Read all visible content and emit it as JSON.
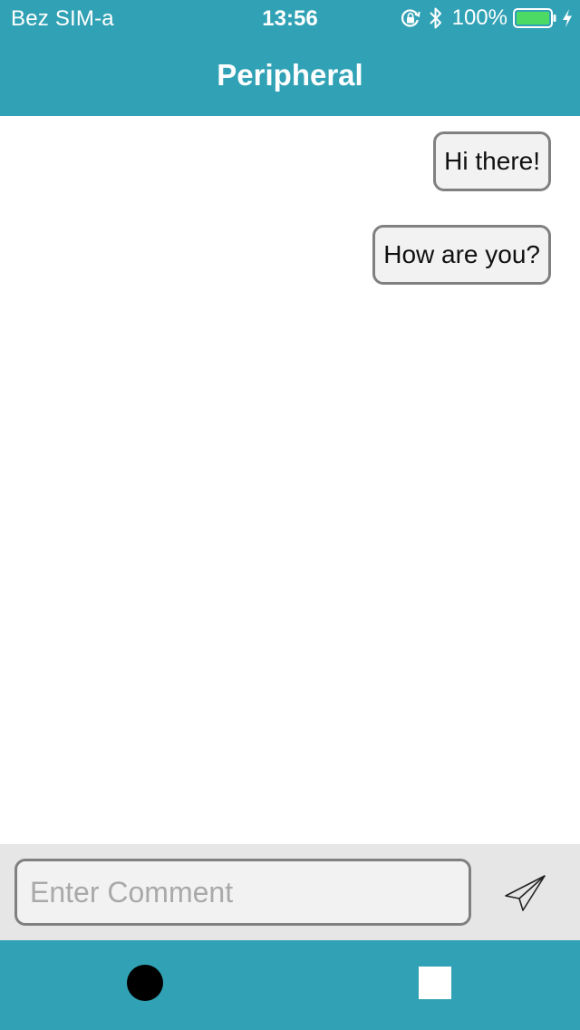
{
  "status_bar": {
    "carrier": "Bez SIM-a",
    "time": "13:56",
    "battery_percent": "100%",
    "battery_level": 1.0,
    "icons": [
      "orientation-lock-icon",
      "bluetooth-icon",
      "battery-icon",
      "charging-bolt-icon"
    ]
  },
  "nav": {
    "title": "Peripheral"
  },
  "messages": [
    {
      "text": "Hi there!"
    },
    {
      "text": "How are you?"
    }
  ],
  "composer": {
    "placeholder": "Enter Comment",
    "send_icon": "paper-plane-icon"
  },
  "toolbar": {
    "record_icon": "circle",
    "stop_icon": "square"
  },
  "colors": {
    "accent": "#31a2b5",
    "bubble_bg": "#f2f2f2",
    "bubble_border": "#808080",
    "composer_bg": "#e6e6e6",
    "battery_fill": "#4cd964",
    "placeholder": "#a9a9a9"
  }
}
